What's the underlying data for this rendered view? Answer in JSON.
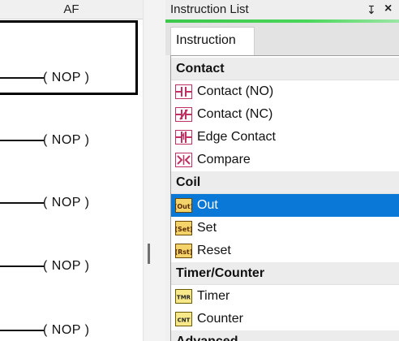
{
  "ladder": {
    "column_header": "AF",
    "rungs": [
      {
        "coil": "( NOP )"
      },
      {
        "coil": "( NOP )"
      },
      {
        "coil": "( NOP )"
      },
      {
        "coil": "( NOP )"
      },
      {
        "coil": "( NOP )"
      }
    ]
  },
  "panel": {
    "title": "Instruction List",
    "pin_glyph": "↧",
    "close_glyph": "×",
    "tab": "Instruction",
    "accent_color": "#3cc84a",
    "selection_color": "#0a78d7"
  },
  "instruction_list": [
    {
      "type": "category",
      "label": "Contact"
    },
    {
      "type": "item",
      "label": "Contact (NO)",
      "icon": "contact-no-icon",
      "selected": false
    },
    {
      "type": "item",
      "label": "Contact (NC)",
      "icon": "contact-nc-icon",
      "selected": false
    },
    {
      "type": "item",
      "label": "Edge Contact",
      "icon": "edge-contact-icon",
      "selected": false
    },
    {
      "type": "item",
      "label": "Compare",
      "icon": "compare-icon",
      "selected": false
    },
    {
      "type": "category",
      "label": "Coil"
    },
    {
      "type": "item",
      "label": "Out",
      "icon": "out-coil-icon",
      "selected": true
    },
    {
      "type": "item",
      "label": "Set",
      "icon": "set-coil-icon",
      "selected": false
    },
    {
      "type": "item",
      "label": "Reset",
      "icon": "reset-coil-icon",
      "selected": false
    },
    {
      "type": "category",
      "label": "Timer/Counter"
    },
    {
      "type": "item",
      "label": "Timer",
      "icon": "timer-icon",
      "selected": false
    },
    {
      "type": "item",
      "label": "Counter",
      "icon": "counter-icon",
      "selected": false
    },
    {
      "type": "category",
      "label": "Advanced"
    }
  ]
}
